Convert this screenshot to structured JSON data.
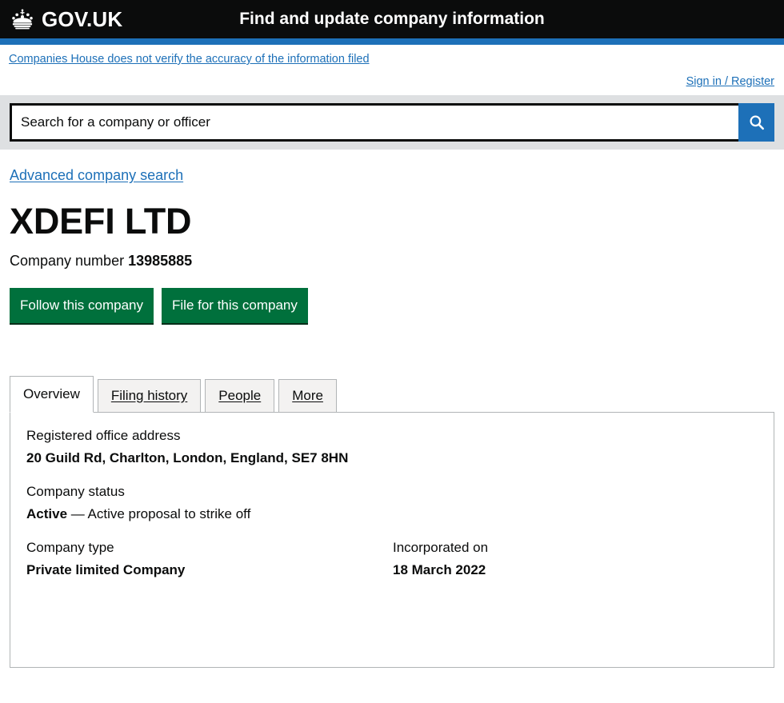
{
  "header": {
    "brand": "GOV.UK",
    "crown_icon": "crown-icon",
    "service_name": "Find and update company information"
  },
  "notice": {
    "text": "Companies House does not verify the accuracy of the information filed"
  },
  "account": {
    "signin_label": "Sign in / Register"
  },
  "search": {
    "placeholder": "Search for a company or officer",
    "value": "",
    "button_icon": "search-icon",
    "advanced_link": "Advanced company search"
  },
  "company": {
    "name": "XDEFI LTD",
    "number_label": "Company number",
    "number": "13985885"
  },
  "actions": {
    "follow_label": "Follow this company",
    "file_label": "File for this company"
  },
  "tabs": [
    {
      "label": "Overview",
      "active": true
    },
    {
      "label": "Filing history",
      "active": false
    },
    {
      "label": "People",
      "active": false
    },
    {
      "label": "More",
      "active": false
    }
  ],
  "overview": {
    "address_label": "Registered office address",
    "address_value": "20 Guild Rd, Charlton, London, England, SE7 8HN",
    "status_label": "Company status",
    "status_value": "Active",
    "status_suffix": " — Active proposal to strike off",
    "type_label": "Company type",
    "type_value": "Private limited Company",
    "incorporated_label": "Incorporated on",
    "incorporated_value": "18 March 2022"
  },
  "colors": {
    "header_black": "#0b0c0c",
    "govuk_blue": "#1d70b8",
    "govuk_green": "#00703c",
    "search_strip_grey": "#dee0e2",
    "tab_grey": "#f3f2f1",
    "border_grey": "#b1b4b6"
  }
}
